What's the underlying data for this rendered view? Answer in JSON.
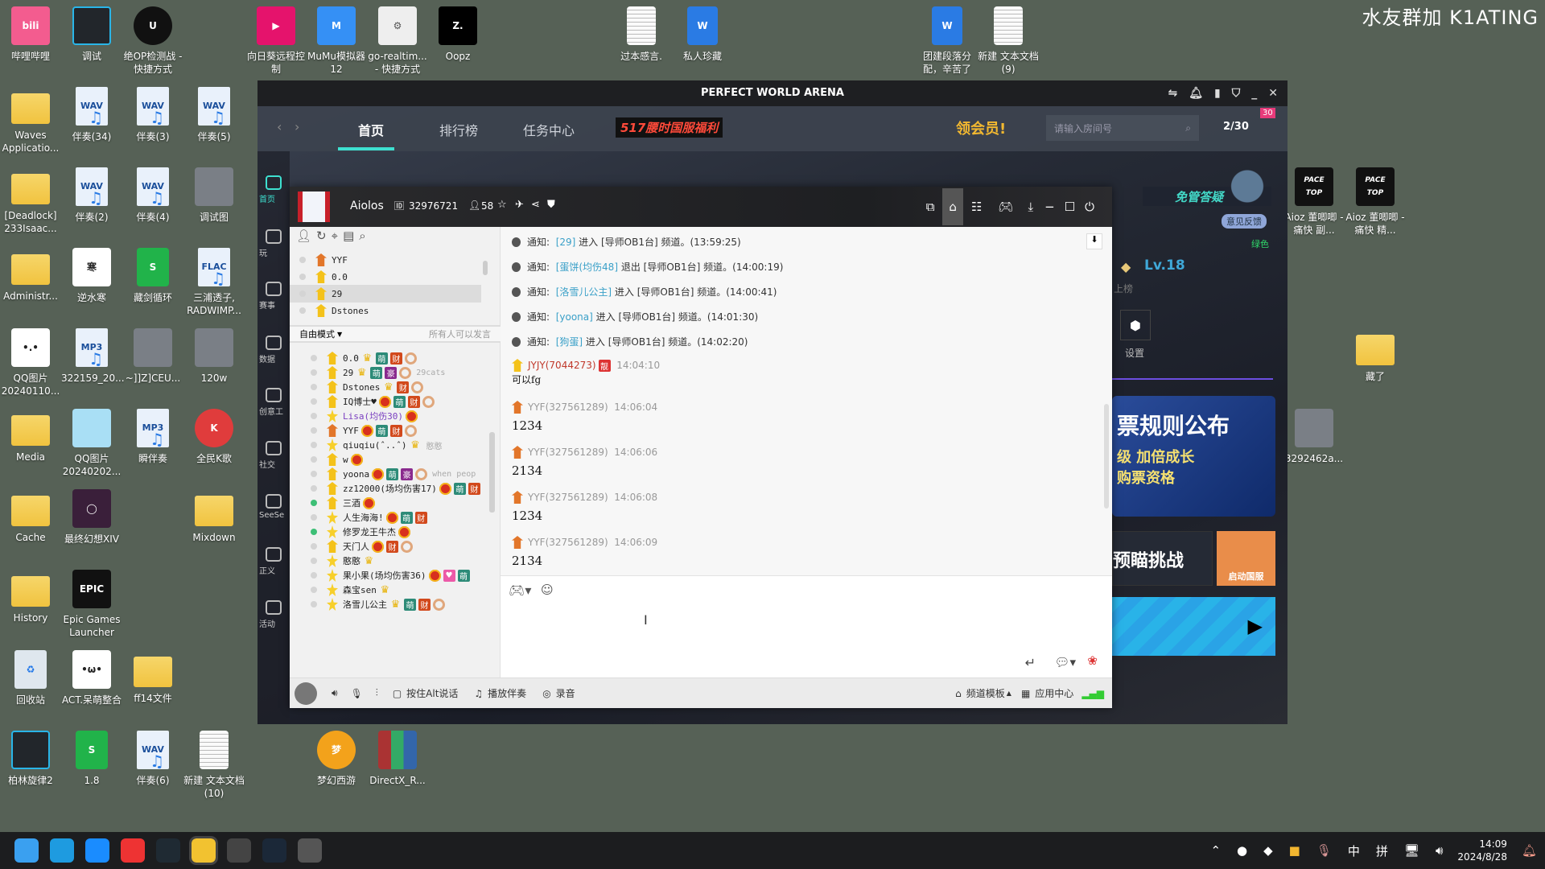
{
  "watermark": "水友群加  K1ATING",
  "desktop": {
    "icons": [
      {
        "label": "哔哩哔哩",
        "type": "bili",
        "glyph": "bili"
      },
      {
        "label": "调试",
        "type": "dark",
        "glyph": ""
      },
      {
        "label": "绝OP检测战 - 快捷方式",
        "type": "unreal",
        "glyph": "U"
      },
      {
        "label": "向日葵远程控制",
        "type": "pink",
        "glyph": "▶"
      },
      {
        "label": "MuMu模拟器12",
        "type": "mumu",
        "glyph": "M"
      },
      {
        "label": "go-realtim... - 快捷方式",
        "type": "gear",
        "glyph": "⚙"
      },
      {
        "label": "Oopz",
        "type": "oopz",
        "glyph": "Z."
      },
      {
        "label": "过本感言.",
        "type": "txt",
        "glyph": ""
      },
      {
        "label": "私人珍藏",
        "type": "word",
        "glyph": "W"
      },
      {
        "label": "团建段落分配，辛苦了",
        "type": "word",
        "glyph": "W"
      },
      {
        "label": "新建 文本文档 (9)",
        "type": "txt",
        "glyph": ""
      },
      {
        "label": "Waves Applicatio...",
        "type": "folder",
        "glyph": ""
      },
      {
        "label": "伴奏(34)",
        "type": "wav",
        "glyph": "WAV"
      },
      {
        "label": "伴奏(3)",
        "type": "wav",
        "glyph": "WAV"
      },
      {
        "label": "伴奏(5)",
        "type": "wav",
        "glyph": "WAV"
      },
      {
        "label": "[Deadlock] 233Isaac...",
        "type": "folder",
        "glyph": ""
      },
      {
        "label": "伴奏(2)",
        "type": "wav",
        "glyph": "WAV"
      },
      {
        "label": "伴奏(4)",
        "type": "wav",
        "glyph": "WAV"
      },
      {
        "label": "调试图",
        "type": "img",
        "glyph": ""
      },
      {
        "label": "Administr...",
        "type": "folder",
        "glyph": ""
      },
      {
        "label": "逆水寒",
        "type": "white",
        "glyph": "寒"
      },
      {
        "label": "藏剑循环",
        "type": "sheet",
        "glyph": "S"
      },
      {
        "label": "三浦透子, RADWIMP...",
        "type": "flac",
        "glyph": "FLAC"
      },
      {
        "label": "QQ图片20240110...",
        "type": "white",
        "glyph": "•.•"
      },
      {
        "label": "322159_20...",
        "type": "mp3",
        "glyph": "MP3"
      },
      {
        "label": "~]]Z]CEU...",
        "type": "img",
        "glyph": ""
      },
      {
        "label": "120w",
        "type": "img",
        "glyph": ""
      },
      {
        "label": "Media",
        "type": "folder",
        "glyph": ""
      },
      {
        "label": "QQ图片20240202...",
        "type": "light",
        "glyph": ""
      },
      {
        "label": "瞬伴奏",
        "type": "mp3",
        "glyph": "MP3"
      },
      {
        "label": "全民K歌",
        "type": "red",
        "glyph": "K"
      },
      {
        "label": "Cache",
        "type": "folder",
        "glyph": ""
      },
      {
        "label": "最终幻想XIV",
        "type": "game",
        "glyph": "◯"
      },
      {
        "label": "Mixdown",
        "type": "folder",
        "glyph": ""
      },
      {
        "label": "History",
        "type": "folder",
        "glyph": ""
      },
      {
        "label": "Epic Games Launcher",
        "type": "epic",
        "glyph": "EPIC"
      },
      {
        "label": "回收站",
        "type": "bin",
        "glyph": "♻"
      },
      {
        "label": "ACT.呆萌整合",
        "type": "white",
        "glyph": "•ω•"
      },
      {
        "label": "ff14文件",
        "type": "folder",
        "glyph": ""
      },
      {
        "label": "柏林旋律2",
        "type": "dark",
        "glyph": ""
      },
      {
        "label": "1.8",
        "type": "sheet",
        "glyph": "S"
      },
      {
        "label": "伴奏(6)",
        "type": "wav",
        "glyph": "WAV"
      },
      {
        "label": "新建 文本文档 (10)",
        "type": "txt",
        "glyph": ""
      },
      {
        "label": "梦幻西游",
        "type": "fantasy",
        "glyph": "梦"
      },
      {
        "label": "DirectX_R...",
        "type": "rar",
        "glyph": ""
      },
      {
        "label": "Aioz 董唧唧 - 痛快 副...",
        "type": "pace",
        "glyph": "PACE TOP"
      },
      {
        "label": "Aioz 董唧唧 - 痛快 精...",
        "type": "pace",
        "glyph": "PACE TOP"
      },
      {
        "label": "藏了",
        "type": "folder",
        "glyph": ""
      },
      {
        "label": "3292462a...",
        "type": "img",
        "glyph": ""
      }
    ]
  },
  "taskbar": {
    "apps": [
      "windows-start-icon",
      "edge-icon",
      "kugou-icon",
      "netease-music-icon",
      "bolin-icon",
      "qq-pet-icon",
      "browser-icon",
      "steam-icon",
      "game-icon"
    ],
    "tray": {
      "ime_lang": "中",
      "ime_mode": "拼",
      "time": "14:09",
      "date": "2024/8/28"
    }
  },
  "pwa": {
    "title": "PERFECT WORLD ARENA",
    "nav": {
      "tabs": [
        "首页",
        "排行榜",
        "任务中心"
      ],
      "active": 0,
      "promo": "517腰时国服福利",
      "vip": "领会员!",
      "search_placeholder": "请输入房间号",
      "room_count": "2/30",
      "badge": "30"
    },
    "sidebar": [
      "首页",
      "玩",
      "赛事",
      "数据",
      "创意工",
      "社交",
      "SeeSe",
      "正义",
      "活动"
    ],
    "right": {
      "faq": "免管答疑",
      "feedback": "意见反馈",
      "status": "绿色",
      "level": "Lv.18",
      "rank_text": "上榜",
      "settings": "设置",
      "banner1": [
        "票规则公布",
        "级 加倍成长",
        "购票资格"
      ],
      "banner2": "预瞄挑战",
      "banner2_img": "启动国服"
    },
    "accent": "#3ee0d0"
  },
  "yy": {
    "header": {
      "name": "Aiolos",
      "id": "32976721",
      "online": "58"
    },
    "top_list": [
      {
        "name": "YYF"
      },
      {
        "name": "0.0"
      },
      {
        "name": "29",
        "selected": true
      },
      {
        "name": "Dstones"
      }
    ],
    "mode": {
      "label": "自由模式",
      "right": "所有人可以发言"
    },
    "badge_labels": {
      "meng": "萌",
      "cai": "财",
      "hao": "豪",
      "crown": "",
      "crown-small": "♛",
      "donut": "",
      "heart": "♥"
    },
    "members": [
      {
        "name": "0.0",
        "role": "gift",
        "badges": [
          "crown-small",
          "meng",
          "cai",
          "donut"
        ]
      },
      {
        "name": "29",
        "role": "gift",
        "badges": [
          "crown-small",
          "meng",
          "hao",
          "donut"
        ],
        "note": "29cats"
      },
      {
        "name": "Dstones",
        "role": "gift",
        "badges": [
          "crown-small",
          "cai",
          "donut"
        ]
      },
      {
        "name": "IQ博士♥",
        "role": "gift",
        "badges": [
          "crown",
          "meng",
          "cai",
          "donut"
        ]
      },
      {
        "name": "Lisa(均伤30)",
        "role": "star",
        "badges": [
          "crown"
        ],
        "color": "#7a3fc0"
      },
      {
        "name": "YYF",
        "role": "orange",
        "badges": [
          "crown",
          "meng",
          "cai",
          "donut"
        ]
      },
      {
        "name": "qiuqiu(ˆ..ˆ)",
        "role": "star",
        "badges": [
          "crown-small"
        ],
        "note": "憨憨"
      },
      {
        "name": "w",
        "role": "gift",
        "badges": [
          "crown"
        ]
      },
      {
        "name": "yoona",
        "role": "gift",
        "badges": [
          "crown",
          "meng",
          "hao",
          "donut"
        ],
        "note": "when peop"
      },
      {
        "name": "zz12000(场均伤害17)",
        "role": "gift",
        "badges": [
          "crown",
          "meng",
          "cai"
        ]
      },
      {
        "name": "三酒",
        "role": "gift",
        "badges": [
          "crown"
        ],
        "online": true
      },
      {
        "name": "人生海海!",
        "role": "star",
        "badges": [
          "crown",
          "meng",
          "cai"
        ]
      },
      {
        "name": "修罗龙王牛杰",
        "role": "star",
        "badges": [
          "crown"
        ],
        "online": true
      },
      {
        "name": "天门人",
        "role": "gift",
        "badges": [
          "crown",
          "cai",
          "donut"
        ]
      },
      {
        "name": "憨憨",
        "role": "star",
        "badges": [
          "crown-small"
        ]
      },
      {
        "name": "果小果(场均伤害36)",
        "role": "star",
        "badges": [
          "crown",
          "heart",
          "meng"
        ]
      },
      {
        "name": "森宝sen",
        "role": "star",
        "badges": [
          "crown-small"
        ]
      },
      {
        "name": "洛雪儿公主",
        "role": "star",
        "badges": [
          "crown-small",
          "meng",
          "cai",
          "donut"
        ]
      }
    ],
    "notice_label": "通知:",
    "notices": [
      {
        "user": "[29]",
        "action": "进入 [导师OB1台] 频道。(13:59:25)"
      },
      {
        "user": "[蛋饼(均伤48]",
        "action": "退出 [导师OB1台] 频道。(14:00:19)"
      },
      {
        "user": "[洛雪儿公主]",
        "action": "进入 [导师OB1台] 频道。(14:00:41)"
      },
      {
        "user": "[yoona]",
        "action": "进入 [导师OB1台] 频道。(14:01:30)"
      },
      {
        "user": "[狗蛋]",
        "action": "进入 [导师OB1台] 频道。(14:02:20)"
      }
    ],
    "messages": [
      {
        "user": "JYJY(7044273)",
        "badge": "靓",
        "time": "14:04:10",
        "text": "可以fg",
        "color": "#c0392b"
      },
      {
        "user": "YYF(327561289)",
        "time": "14:06:04",
        "text": "1234"
      },
      {
        "user": "YYF(327561289)",
        "time": "14:06:06",
        "text": "2134"
      },
      {
        "user": "YYF(327561289)",
        "time": "14:06:08",
        "text": "1234"
      },
      {
        "user": "YYF(327561289)",
        "time": "14:06:09",
        "text": "2134"
      }
    ],
    "bottom": {
      "ptt": "按住Alt说话",
      "accompany": "播放伴奏",
      "record": "录音",
      "template": "频道模板",
      "apps": "应用中心"
    }
  }
}
